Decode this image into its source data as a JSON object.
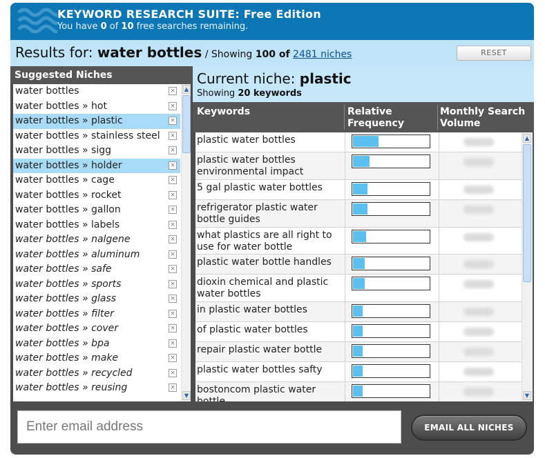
{
  "header": {
    "title": "KEYWORD RESEARCH SUITE: Free Edition",
    "sub_prefix": "You have ",
    "used": "0",
    "sub_middle": " of ",
    "total": "10",
    "sub_suffix": " free searches remaining."
  },
  "results": {
    "label": "Results for:",
    "query": "water bottles",
    "showing_prefix": " / Showing ",
    "showing_count": "100 of",
    "niches_link": "2481 niches",
    "reset_label": "RESET"
  },
  "sidebar": {
    "heading": "Suggested Niches",
    "remove_glyph": "×",
    "items": [
      {
        "label": "water bottles",
        "selected": false,
        "italic": false
      },
      {
        "label": "water bottles » hot",
        "selected": false,
        "italic": false
      },
      {
        "label": "water bottles » plastic",
        "selected": true,
        "italic": false
      },
      {
        "label": "water bottles » stainless steel",
        "selected": false,
        "italic": false
      },
      {
        "label": "water bottles » sigg",
        "selected": false,
        "italic": false
      },
      {
        "label": "water bottles » holder",
        "selected": true,
        "italic": false
      },
      {
        "label": "water bottles » cage",
        "selected": false,
        "italic": false
      },
      {
        "label": "water bottles » rocket",
        "selected": false,
        "italic": false
      },
      {
        "label": "water bottles » gallon",
        "selected": false,
        "italic": false
      },
      {
        "label": "water bottles » labels",
        "selected": false,
        "italic": false
      },
      {
        "label": "water bottles » nalgene",
        "selected": false,
        "italic": true
      },
      {
        "label": "water bottles » aluminum",
        "selected": false,
        "italic": true
      },
      {
        "label": "water bottles » safe",
        "selected": false,
        "italic": true
      },
      {
        "label": "water bottles » sports",
        "selected": false,
        "italic": true
      },
      {
        "label": "water bottles » glass",
        "selected": false,
        "italic": true
      },
      {
        "label": "water bottles » filter",
        "selected": false,
        "italic": true
      },
      {
        "label": "water bottles » cover",
        "selected": false,
        "italic": true
      },
      {
        "label": "water bottles » bpa",
        "selected": false,
        "italic": true
      },
      {
        "label": "water bottles » make",
        "selected": false,
        "italic": true
      },
      {
        "label": "water bottles » recycled",
        "selected": false,
        "italic": true
      },
      {
        "label": "water bottles » reusing",
        "selected": false,
        "italic": true
      }
    ]
  },
  "niche": {
    "label": "Current niche:",
    "name": "plastic",
    "showing_prefix": "Showing ",
    "keyword_count": "20 keywords"
  },
  "table": {
    "columns": [
      "Keywords",
      "Relative Frequency",
      "Monthly Search Volume"
    ],
    "rows": [
      {
        "keyword": "plastic water bottles",
        "frequency": 0.34
      },
      {
        "keyword": "plastic water bottles environmental impact",
        "frequency": 0.22
      },
      {
        "keyword": "5 gal plastic water bottles",
        "frequency": 0.19
      },
      {
        "keyword": "refrigerator plastic water bottle guides",
        "frequency": 0.19
      },
      {
        "keyword": "what plastics are all right to use for water bottle",
        "frequency": 0.17
      },
      {
        "keyword": "plastic water bottle handles",
        "frequency": 0.15
      },
      {
        "keyword": "dioxin chemical and plastic water bottles",
        "frequency": 0.15
      },
      {
        "keyword": "in plastic water bottles",
        "frequency": 0.13
      },
      {
        "keyword": "of plastic water bottles",
        "frequency": 0.13
      },
      {
        "keyword": "repair plastic water bottle",
        "frequency": 0.13
      },
      {
        "keyword": "plastic water bottles safty",
        "frequency": 0.13
      },
      {
        "keyword": "bostoncom plastic water bottle",
        "frequency": 0.13
      }
    ]
  },
  "footer": {
    "email_placeholder": "Enter email address",
    "email_button": "EMAIL ALL NICHES"
  },
  "colors": {
    "header_bg": "#0d77b5",
    "results_bg": "#bfe3f7",
    "selected_bg": "#a7dbf6",
    "bar_fill": "#5bc0f0",
    "panel_dark": "#4d4d4d"
  },
  "icons": {
    "logo": "waves-icon",
    "remove": "remove-niche-icon",
    "scroll_up": "scroll-up-icon",
    "scroll_down": "scroll-down-icon"
  }
}
